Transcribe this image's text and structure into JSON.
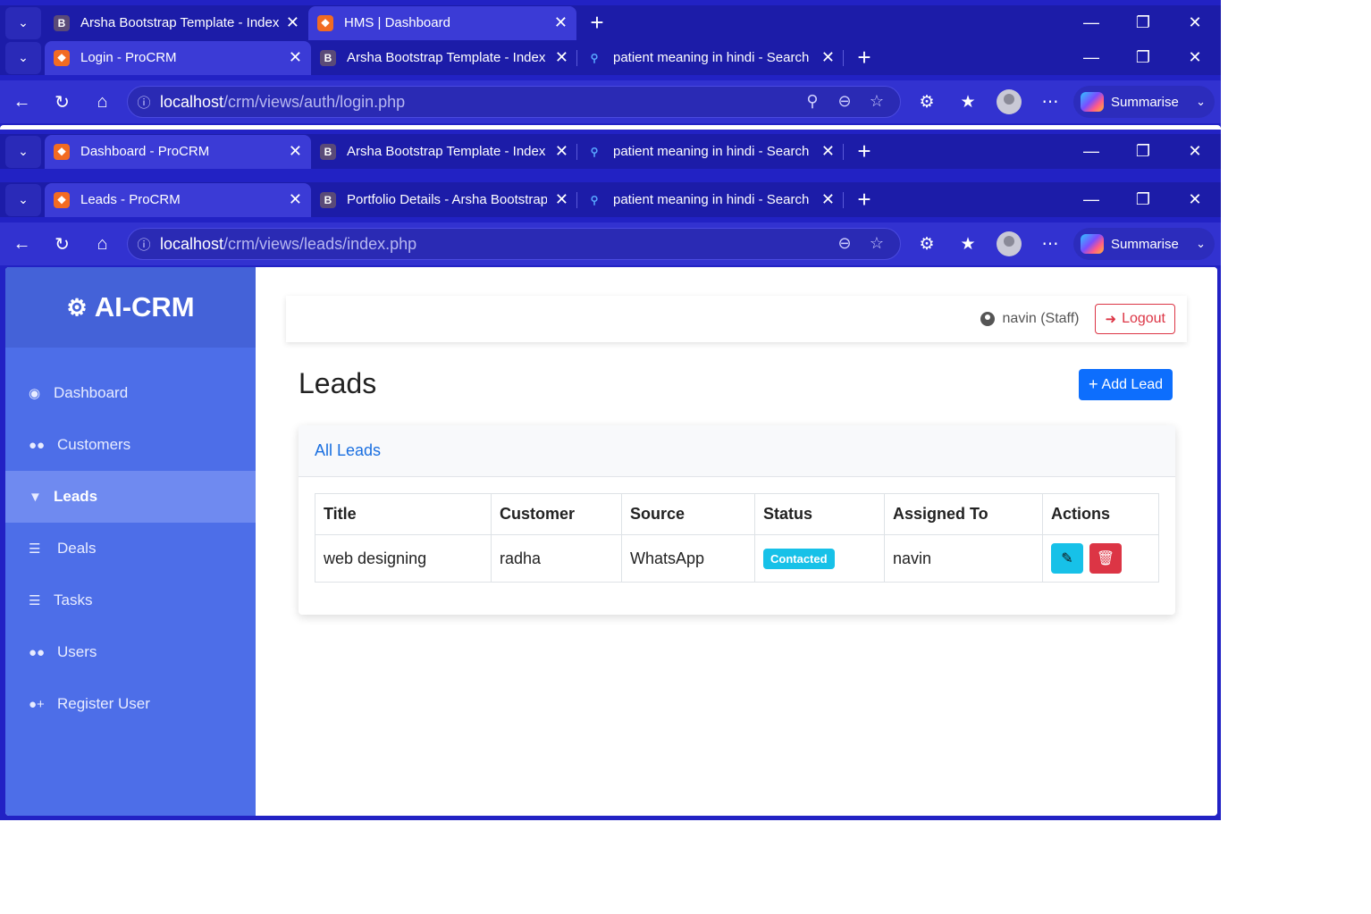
{
  "browser": {
    "layers": [
      {
        "tabs": [
          {
            "label": "Arsha Bootstrap Template - Index",
            "icon": "bootstrap-icon",
            "active": false
          },
          {
            "label": "HMS | Dashboard",
            "icon": "xampp-icon",
            "active": true
          }
        ]
      },
      {
        "tabs": [
          {
            "label": "Login - ProCRM",
            "icon": "xampp-icon",
            "active": true
          },
          {
            "label": "Arsha Bootstrap Template - Index",
            "icon": "bootstrap-icon",
            "active": false
          },
          {
            "label": "patient meaning in hindi - Search",
            "icon": "search-icon",
            "active": false
          }
        ],
        "url_host": "localhost",
        "url_path": "/crm/views/auth/login.php"
      },
      {
        "tabs": [
          {
            "label": "Dashboard - ProCRM",
            "icon": "xampp-icon",
            "active": true
          },
          {
            "label": "Arsha Bootstrap Template - Index",
            "icon": "bootstrap-icon",
            "active": false
          },
          {
            "label": "patient meaning in hindi - Search",
            "icon": "search-icon",
            "active": false
          }
        ]
      },
      {
        "tabs": [
          {
            "label": "Leads - ProCRM",
            "icon": "xampp-icon",
            "active": true
          },
          {
            "label": "Portfolio Details - Arsha Bootstrap",
            "icon": "bootstrap-icon",
            "active": false
          },
          {
            "label": "patient meaning in hindi - Search",
            "icon": "search-icon",
            "active": false
          }
        ],
        "url_host": "localhost",
        "url_path": "/crm/views/leads/index.php"
      }
    ],
    "summarise_label": "Summarise"
  },
  "app": {
    "brand": "AI-CRM",
    "nav": [
      {
        "label": "Dashboard",
        "icon": "dashboard-icon"
      },
      {
        "label": "Customers",
        "icon": "customers-icon"
      },
      {
        "label": "Leads",
        "icon": "filter-icon",
        "active": true
      },
      {
        "label": "Deals",
        "icon": "handshake-icon"
      },
      {
        "label": "Tasks",
        "icon": "tasks-icon"
      },
      {
        "label": "Users",
        "icon": "users-icon"
      },
      {
        "label": "Register User",
        "icon": "user-plus-icon"
      }
    ],
    "user_label": "navin (Staff)",
    "logout_label": "Logout",
    "page_title": "Leads",
    "add_button_label": "Add Lead",
    "card_title": "All Leads",
    "table": {
      "headers": [
        "Title",
        "Customer",
        "Source",
        "Status",
        "Assigned To",
        "Actions"
      ],
      "rows": [
        {
          "title": "web designing",
          "customer": "radha",
          "source": "WhatsApp",
          "status": "Contacted",
          "assigned_to": "navin"
        }
      ]
    },
    "colors": {
      "sidebar": "#4d6ee8",
      "primary": "#0d6efd",
      "danger": "#dc3545",
      "info": "#17c1e8"
    }
  }
}
